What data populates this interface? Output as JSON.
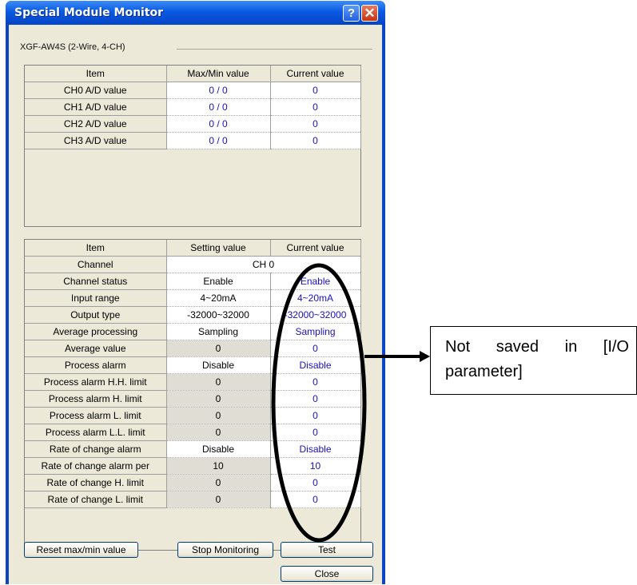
{
  "window": {
    "title": "Special Module Monitor"
  },
  "module_name": "XGF-AW4S (2-Wire, 4-CH)",
  "table1": {
    "headers": [
      "Item",
      "Max/Min value",
      "Current value"
    ],
    "rows": [
      {
        "item": "CH0 A/D value",
        "maxmin": "0 / 0",
        "current": "0"
      },
      {
        "item": "CH1 A/D value",
        "maxmin": "0 / 0",
        "current": "0"
      },
      {
        "item": "CH2 A/D value",
        "maxmin": "0 / 0",
        "current": "0"
      },
      {
        "item": "CH3 A/D value",
        "maxmin": "0 / 0",
        "current": "0"
      }
    ]
  },
  "table2": {
    "headers": [
      "Item",
      "Setting value",
      "Current value"
    ],
    "channel_label": "Channel",
    "channel_value": "CH 0",
    "rows": [
      {
        "item": "Channel status",
        "setting": "Enable",
        "current": "Enable"
      },
      {
        "item": "Input range",
        "setting": "4~20mA",
        "current": "4~20mA"
      },
      {
        "item": "Output type",
        "setting": "-32000~32000",
        "current": "-32000~32000"
      },
      {
        "item": "Average processing",
        "setting": "Sampling",
        "current": "Sampling"
      },
      {
        "item": "Average value",
        "setting": "0",
        "current": "0"
      },
      {
        "item": "Process alarm",
        "setting": "Disable",
        "current": "Disable"
      },
      {
        "item": "Process alarm H.H. limit",
        "setting": "0",
        "current": "0"
      },
      {
        "item": "Process alarm H. limit",
        "setting": "0",
        "current": "0"
      },
      {
        "item": "Process alarm L. limit",
        "setting": "0",
        "current": "0"
      },
      {
        "item": "Process alarm L.L. limit",
        "setting": "0",
        "current": "0"
      },
      {
        "item": "Rate of change alarm",
        "setting": "Disable",
        "current": "Disable"
      },
      {
        "item": "Rate of change alarm per",
        "setting": "10",
        "current": "10"
      },
      {
        "item": "Rate of change H. limit",
        "setting": "0",
        "current": "0"
      },
      {
        "item": "Rate of change L. limit",
        "setting": "0",
        "current": "0"
      }
    ]
  },
  "buttons": {
    "reset": "Reset max/min value",
    "stop": "Stop Monitoring",
    "test": "Test",
    "close": "Close"
  },
  "annotation": {
    "line1_words": [
      "Not",
      "saved",
      "in",
      "[I/O"
    ],
    "line2": "parameter]"
  },
  "colors": {
    "current_value": "#1a10c8",
    "titlebar": "#0a5ae3"
  }
}
